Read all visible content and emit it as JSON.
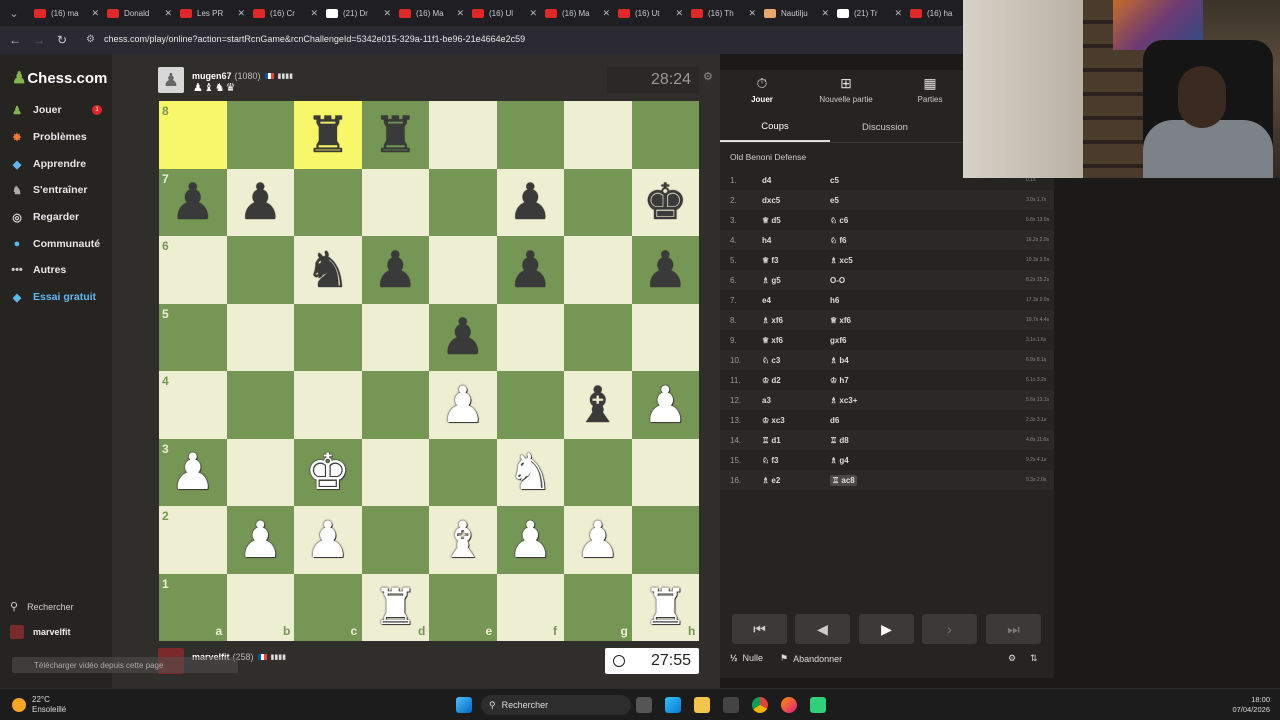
{
  "browser": {
    "tabs": [
      {
        "title": "(16) ma",
        "color": "#e02828"
      },
      {
        "title": "Donald",
        "color": "#e02828"
      },
      {
        "title": "Les PR",
        "color": "#e02828"
      },
      {
        "title": "(16) Cr",
        "color": "#e02828"
      },
      {
        "title": "(21) Dr",
        "color": "#ffffff"
      },
      {
        "title": "(16) Ma",
        "color": "#e02828"
      },
      {
        "title": "(16) Ul",
        "color": "#e02828"
      },
      {
        "title": "(16) Ma",
        "color": "#e02828"
      },
      {
        "title": "(16) Ut",
        "color": "#e02828"
      },
      {
        "title": "(16) Th",
        "color": "#e02828"
      },
      {
        "title": "Nautilju",
        "color": "#e8a76b"
      },
      {
        "title": "(21) Tr",
        "color": "#ffffff"
      },
      {
        "title": "(16) ha",
        "color": "#e02828"
      }
    ],
    "url": "chess.com/play/online?action=startRcnGame&rcnChallengeId=5342e015-329a-11f1-be96-21e4664e2c59"
  },
  "sidebar": {
    "logo": "Chess.com",
    "items": [
      {
        "label": "Jouer",
        "icon": "pawn-play-icon",
        "badge": "1"
      },
      {
        "label": "Problèmes",
        "icon": "puzzle-icon"
      },
      {
        "label": "Apprendre",
        "icon": "learn-icon"
      },
      {
        "label": "S'entraîner",
        "icon": "train-icon"
      },
      {
        "label": "Regarder",
        "icon": "binoculars-icon"
      },
      {
        "label": "Communauté",
        "icon": "community-icon"
      },
      {
        "label": "Autres",
        "icon": "more-icon"
      },
      {
        "label": "Essai gratuit",
        "icon": "diamond-icon"
      }
    ],
    "search_label": "Rechercher",
    "user_label": "marvelfit"
  },
  "game": {
    "top_player": {
      "name": "mugen67",
      "rating": "(1080)",
      "captured": "♟♝♞♛"
    },
    "bottom_player": {
      "name": "marvelfit",
      "rating": "(258)"
    },
    "top_clock": "28:24",
    "bottom_clock": "27:55",
    "ranks": [
      "8",
      "7",
      "6",
      "5",
      "4",
      "3",
      "2",
      "1"
    ],
    "files": [
      "a",
      "b",
      "c",
      "d",
      "e",
      "f",
      "g",
      "h"
    ],
    "highlight_squares": [
      "a8",
      "c8"
    ],
    "pieces": [
      {
        "sq": "c8",
        "p": "♜",
        "c": "b"
      },
      {
        "sq": "d8",
        "p": "♜",
        "c": "b"
      },
      {
        "sq": "a7",
        "p": "♟",
        "c": "b"
      },
      {
        "sq": "b7",
        "p": "♟",
        "c": "b"
      },
      {
        "sq": "f7",
        "p": "♟",
        "c": "b"
      },
      {
        "sq": "h7",
        "p": "♚",
        "c": "b"
      },
      {
        "sq": "c6",
        "p": "♞",
        "c": "b"
      },
      {
        "sq": "d6",
        "p": "♟",
        "c": "b"
      },
      {
        "sq": "f6",
        "p": "♟",
        "c": "b"
      },
      {
        "sq": "h6",
        "p": "♟",
        "c": "b"
      },
      {
        "sq": "e5",
        "p": "♟",
        "c": "b"
      },
      {
        "sq": "e4",
        "p": "♙",
        "c": "w"
      },
      {
        "sq": "g4",
        "p": "♝",
        "c": "b"
      },
      {
        "sq": "h4",
        "p": "♙",
        "c": "w"
      },
      {
        "sq": "a3",
        "p": "♙",
        "c": "w"
      },
      {
        "sq": "c3",
        "p": "♔",
        "c": "w"
      },
      {
        "sq": "f3",
        "p": "♘",
        "c": "w"
      },
      {
        "sq": "b2",
        "p": "♙",
        "c": "w"
      },
      {
        "sq": "c2",
        "p": "♙",
        "c": "w"
      },
      {
        "sq": "e2",
        "p": "♗",
        "c": "w"
      },
      {
        "sq": "f2",
        "p": "♙",
        "c": "w"
      },
      {
        "sq": "g2",
        "p": "♙",
        "c": "w"
      },
      {
        "sq": "d1",
        "p": "♖",
        "c": "w"
      },
      {
        "sq": "h1",
        "p": "♖",
        "c": "w"
      }
    ]
  },
  "panel": {
    "top_tabs": [
      {
        "label": "Jouer",
        "icon": "stopwatch-icon"
      },
      {
        "label": "Nouvelle partie",
        "icon": "plus-icon"
      },
      {
        "label": "Parties",
        "icon": "board-icon"
      }
    ],
    "tabs": [
      "Coups",
      "Discussion"
    ],
    "opening": "Old Benoni Defense",
    "moves": [
      {
        "n": "1.",
        "w": "d4",
        "b": "c5",
        "t": "0.1s"
      },
      {
        "n": "2.",
        "w": "dxc5",
        "b": "e5",
        "t": "3.0s 1.7s"
      },
      {
        "n": "3.",
        "w": "♕ d5",
        "b": "♘ c6",
        "t": "6.8s 13.0s"
      },
      {
        "n": "4.",
        "w": "h4",
        "b": "♘ f6",
        "t": "16.2s 2.0s"
      },
      {
        "n": "5.",
        "w": "♕ f3",
        "b": "♗ xc5",
        "t": "10.3s 3.5s"
      },
      {
        "n": "6.",
        "w": "♗ g5",
        "b": "O-O",
        "t": "8.2s 15.2s"
      },
      {
        "n": "7.",
        "w": "e4",
        "b": "h6",
        "t": "17.3s 9.0s"
      },
      {
        "n": "8.",
        "w": "♗ xf6",
        "b": "♕ xf6",
        "t": "10.7s 4.4s"
      },
      {
        "n": "9.",
        "w": "♕ xf6",
        "b": "gxf6",
        "t": "3.1s 1.6s"
      },
      {
        "n": "10.",
        "w": "♘ c3",
        "b": "♗ b4",
        "t": "6.9s 8.1s"
      },
      {
        "n": "11.",
        "w": "♔ d2",
        "b": "♔ h7",
        "t": "6.1s 3.2s"
      },
      {
        "n": "12.",
        "w": "a3",
        "b": "♗ xc3+",
        "t": "5.6s 13.1s"
      },
      {
        "n": "13.",
        "w": "♔ xc3",
        "b": "d6",
        "t": "2.3s 3.1s"
      },
      {
        "n": "14.",
        "w": "♖ d1",
        "b": "♖ d8",
        "t": "4.8s 11.6s"
      },
      {
        "n": "15.",
        "w": "♘ f3",
        "b": "♗ g4",
        "t": "9.2s 4.1s"
      },
      {
        "n": "16.",
        "w": "♗ e2",
        "b": "♖ ac8",
        "t": "9.3s 2.0s"
      }
    ],
    "draw_label": "Nulle",
    "resign_label": "Abandonner"
  },
  "toast": "Télécharger vidéo depuis cette page",
  "taskbar": {
    "temp": "22°C",
    "weather": "Ensoleillé",
    "search": "Rechercher",
    "time": "18:00",
    "date": "07/04/2026"
  }
}
